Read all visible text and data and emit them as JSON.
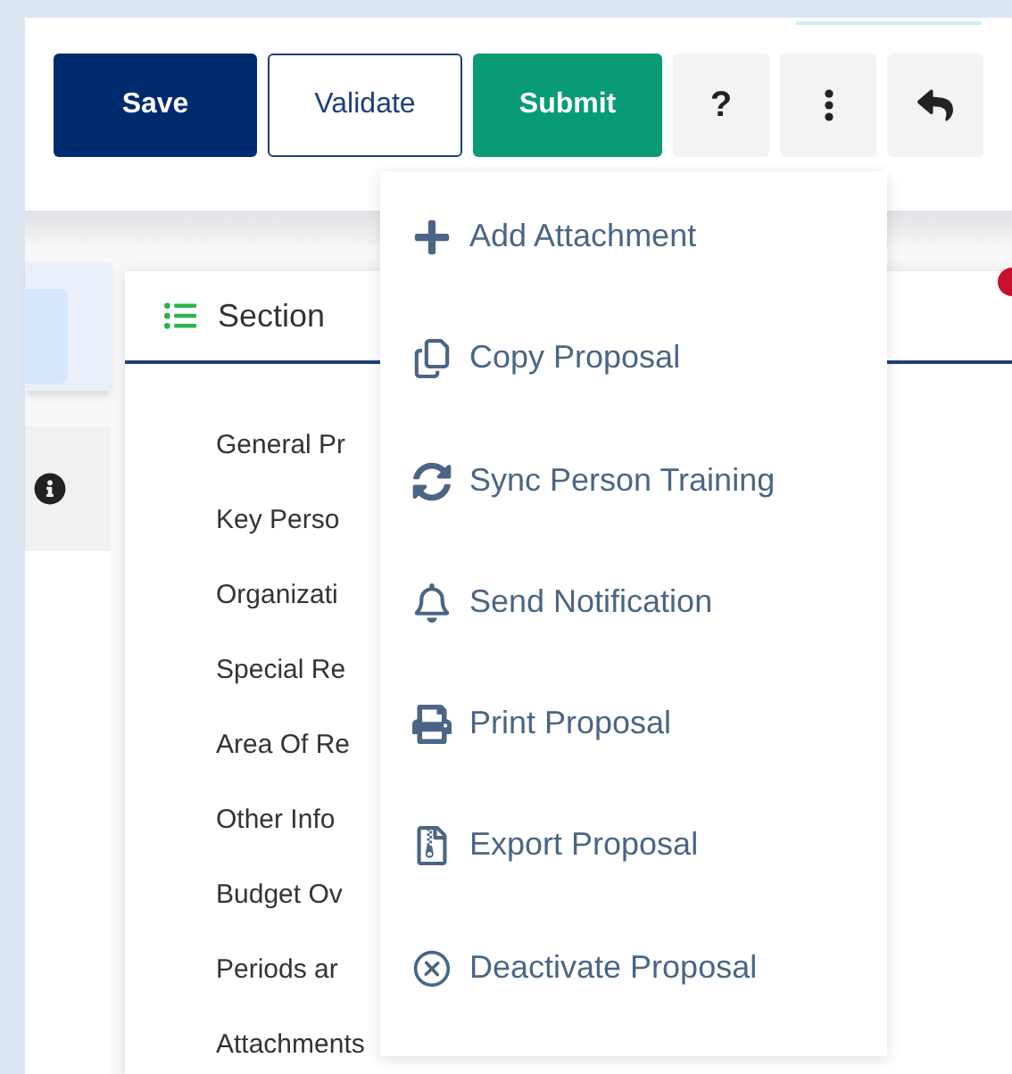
{
  "toolbar": {
    "buttons": [
      {
        "kind": "primary",
        "label": "Save"
      },
      {
        "kind": "outline",
        "label": "Validate"
      },
      {
        "kind": "success",
        "label": "Submit"
      },
      {
        "kind": "help",
        "label": "?"
      },
      {
        "kind": "more"
      },
      {
        "kind": "back"
      }
    ]
  },
  "section_panel": {
    "tab": "Section",
    "items": [
      "General Pr",
      "Key Perso",
      "Organizati",
      "Special Re",
      "Area Of Re",
      "Other Info",
      "Budget Ov",
      "Periods ar",
      "Attachments"
    ]
  },
  "actions_menu": {
    "open": true,
    "items": [
      {
        "kind": "add",
        "label": "Add Attachment"
      },
      {
        "kind": "copy",
        "label": "Copy Proposal"
      },
      {
        "kind": "sync",
        "label": "Sync Person Training"
      },
      {
        "kind": "notify",
        "label": "Send Notification"
      },
      {
        "kind": "print",
        "label": "Print Proposal"
      },
      {
        "kind": "export",
        "label": "Export Proposal"
      },
      {
        "kind": "deactivate",
        "label": "Deactivate Proposal"
      }
    ]
  }
}
